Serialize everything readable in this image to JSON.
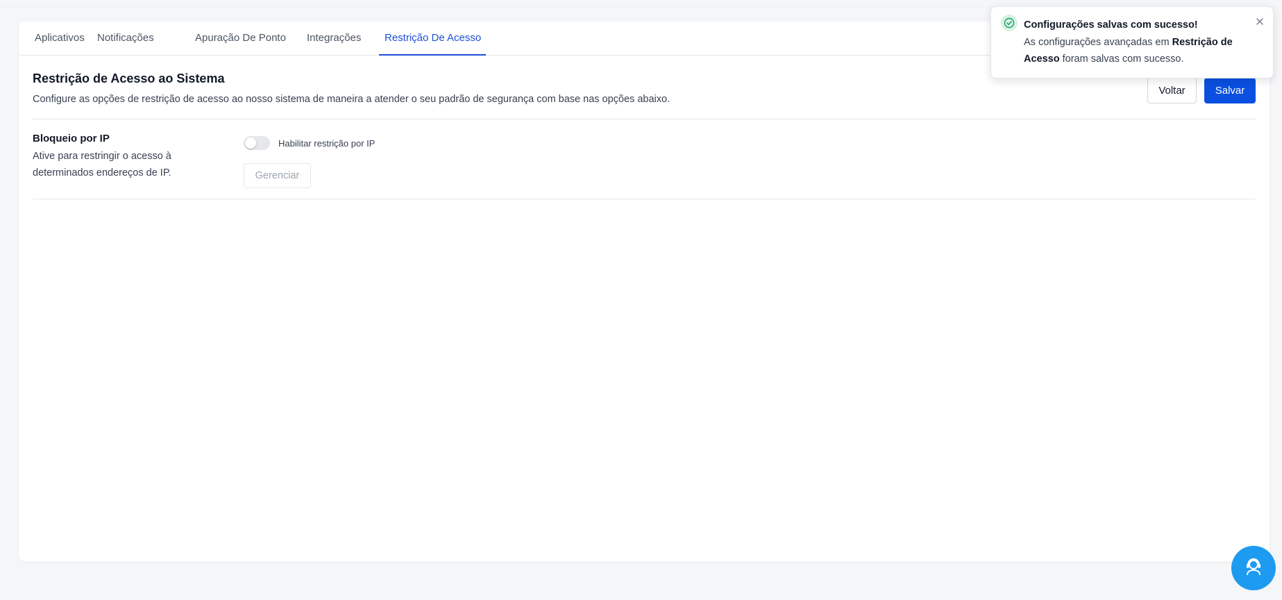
{
  "tabs": [
    {
      "label": "Aplicativos",
      "active": false
    },
    {
      "label": "Notificações",
      "active": false
    },
    {
      "label": "Apuração De Ponto",
      "active": false
    },
    {
      "label": "Integrações",
      "active": false
    },
    {
      "label": "Restrição De Acesso",
      "active": true
    }
  ],
  "section": {
    "title": "Restrição de Acesso ao Sistema",
    "description": "Configure as opções de restrição de acesso ao nosso sistema de maneira a atender o seu padrão de segurança com base nas opções abaixo."
  },
  "actions": {
    "back_label": "Voltar",
    "save_label": "Salvar"
  },
  "ip_block": {
    "title": "Bloqueio por IP",
    "description": "Ative para restringir o acesso à determinados endereços de IP.",
    "toggle_label": "Habilitar restrição por IP",
    "toggle_enabled": false,
    "manage_label": "Gerenciar",
    "manage_disabled": true
  },
  "toast": {
    "title": "Configurações salvas com sucesso!",
    "body_prefix": "As configurações avançadas em",
    "body_highlight": "Restrição de Acesso",
    "body_suffix": "foram salvas com sucesso.",
    "icon": "check-circle-icon",
    "close_icon": "close-icon"
  },
  "support_fab": {
    "icon": "support-agent-icon"
  },
  "colors": {
    "accent": "#1d4ed8",
    "primary_button": "#0a4fe0",
    "fab": "#1d9bf0",
    "success": "#15a060"
  }
}
